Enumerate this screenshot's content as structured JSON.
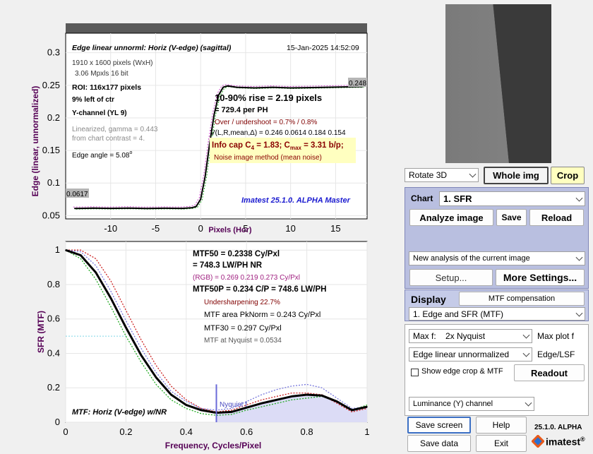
{
  "colors": {
    "panel_blue": "#b9bfe0",
    "crop_yellow": "#ffffc0",
    "purple_label": "#550055",
    "title_blue": "#1b1bd0",
    "info_yellow": "#ffffc0"
  },
  "edge_plot": {
    "title": "Edge linear unnorml: Horiz (V-edge) (sagittal)",
    "date": "15-Jan-2025 14:52:09",
    "size_line": "1910 x 1600 pixels (WxH)",
    "mpxls_line": "3.06 Mpxls   16 bit",
    "roi_line": "ROI:  116x177 pixels",
    "pos_line": "9% left of ctr",
    "channel_line": "Y-channel  (YL 9)",
    "linearized_line": "Linearized, gamma = 0.443",
    "contrast_line": "from chart contrast = 4.",
    "edge_angle_label": "Edge angle = 5.08",
    "edge_angle_unit": "o",
    "rise_line": "10-90% rise = 2.19 pixels",
    "per_ph_line": "=  729.4 per PH",
    "overshoot_line": "Over / undershoot =  0.7% /  0.8%",
    "v_line": "V(L,R,mean,Δ) = 0.246  0.0614  0.184  0.154",
    "info_cap_prefix": "Info cap C",
    "info_cap_sub": "4",
    "info_cap_mid": " = 1.83;  C",
    "info_cap_sub2": "max",
    "info_cap_suffix": " = 3.31 b/p;",
    "noise_line": "Noise image method (mean noise)",
    "watermark": "Imatest 25.1.0. ALPHA Master",
    "left_value_label": "0.0617",
    "right_value_label": "0.248",
    "ylabel": "Edge (linear, unnormalized)",
    "xlabel": "Pixels (Hor)",
    "yticks": [
      "0.05",
      "0.1",
      "0.15",
      "0.2",
      "0.25",
      "0.3"
    ],
    "xticks": [
      "-10",
      "-5",
      "0",
      "5",
      "10",
      "15"
    ]
  },
  "chart_data": [
    {
      "type": "line",
      "ylabel": "Edge (linear, unnormalized)",
      "xlabel": "Pixels (Hor)",
      "xlim": [
        -15,
        18.5
      ],
      "ylim": [
        0.045,
        0.33
      ],
      "x": [
        -14,
        -12,
        -10,
        -8,
        -6,
        -4,
        -2,
        -1,
        -0.5,
        0,
        0.5,
        1,
        1.5,
        2,
        2.5,
        3,
        4,
        6,
        8,
        10,
        12,
        14,
        16,
        18
      ],
      "series": [
        {
          "values": [
            0.061,
            0.0615,
            0.0612,
            0.0616,
            0.061,
            0.0614,
            0.0612,
            0.062,
            0.064,
            0.075,
            0.11,
            0.16,
            0.205,
            0.235,
            0.247,
            0.249,
            0.247,
            0.246,
            0.247,
            0.246,
            0.2465,
            0.247,
            0.2475,
            0.248
          ]
        }
      ]
    },
    {
      "type": "line",
      "ylabel": "SFR (MTF)",
      "xlabel": "Frequency, Cycles/Pixel",
      "xlim": [
        0,
        1
      ],
      "ylim": [
        0,
        1.05
      ],
      "x": [
        0,
        0.05,
        0.1,
        0.15,
        0.2,
        0.25,
        0.3,
        0.35,
        0.4,
        0.45,
        0.5,
        0.55,
        0.6,
        0.65,
        0.7,
        0.75,
        0.8,
        0.85,
        0.9,
        0.95,
        1.0
      ],
      "series": [
        {
          "values": [
            1.0,
            0.97,
            0.87,
            0.72,
            0.55,
            0.39,
            0.26,
            0.16,
            0.1,
            0.07,
            0.055,
            0.06,
            0.085,
            0.11,
            0.13,
            0.15,
            0.16,
            0.155,
            0.12,
            0.07,
            0.09
          ]
        },
        {
          "values": [
            1.0,
            1.0,
            0.95,
            0.82,
            0.65,
            0.48,
            0.33,
            0.21,
            0.13,
            0.08,
            0.06,
            0.07,
            0.1,
            0.13,
            0.15,
            0.17,
            0.17,
            0.16,
            0.11,
            0.06,
            0.08
          ]
        },
        {
          "values": [
            1.0,
            0.95,
            0.83,
            0.67,
            0.5,
            0.35,
            0.22,
            0.13,
            0.08,
            0.05,
            0.04,
            0.045,
            0.07,
            0.09,
            0.11,
            0.13,
            0.14,
            0.15,
            0.12,
            0.07,
            0.1
          ]
        },
        {
          "values": [
            1.0,
            0.99,
            0.91,
            0.76,
            0.59,
            0.43,
            0.29,
            0.18,
            0.12,
            0.08,
            0.07,
            0.08,
            0.12,
            0.16,
            0.19,
            0.21,
            0.22,
            0.2,
            0.14,
            0.08,
            0.09
          ]
        }
      ]
    }
  ],
  "mtf_plot": {
    "mtf50_line": "MTF50 = 0.2338 Cy/Pxl",
    "lwph_line": "= 748.3 LW/PH  NR",
    "rgb_line": "(RGB) = 0.269  0.219  0.273 Cy/Pxl",
    "mtf50p_line": "MTF50P = 0.234 C/P = 748.6 LW/PH",
    "undersharp_line": "Undersharpening 22.7%",
    "area_line": "MTF area PkNorm = 0.243 Cy/Pxl",
    "mtf30_line": "MTF30 = 0.297 Cy/Pxl",
    "nyq_line": "MTF at Nyquist = 0.0534",
    "nyquist_label": "Nyquist f",
    "footer": "MTF: Horiz (V-edge) w/NR",
    "ylabel": "SFR (MTF)",
    "xlabel": "Frequency, Cycles/Pixel",
    "yticks": [
      "0",
      "0.2",
      "0.4",
      "0.6",
      "0.8",
      "1"
    ],
    "xticks": [
      "0",
      "0.2",
      "0.4",
      "0.6",
      "0.8",
      "1"
    ]
  },
  "controls": {
    "rotate_select": "Rotate 3D",
    "whole_img": "Whole img",
    "crop": "Crop",
    "chart_label": "Chart",
    "chart_select": "1. SFR",
    "analyze": "Analyze image",
    "save": "Save",
    "reload": "Reload",
    "analysis_select": "New analysis of the current image",
    "setup": "Setup...",
    "more_settings": "More Settings...",
    "display_label": "Display",
    "mtf_comp": "MTF compensation",
    "display_select": "1. Edge and SFR (MTF)",
    "maxf_select": "Max f:    2x Nyquist",
    "maxf_label": "Max plot f",
    "edge_select": "Edge linear unnormalized",
    "edge_label": "Edge/LSF",
    "show_edge": "Show edge crop & MTF",
    "readout": "Readout",
    "channel_select": "Luminance (Y) channel",
    "save_screen": "Save screen",
    "help": "Help",
    "version": "25.1.0. ALPHA",
    "save_data": "Save data",
    "exit": "Exit",
    "brand": "imatest",
    "brand_reg": "®"
  }
}
